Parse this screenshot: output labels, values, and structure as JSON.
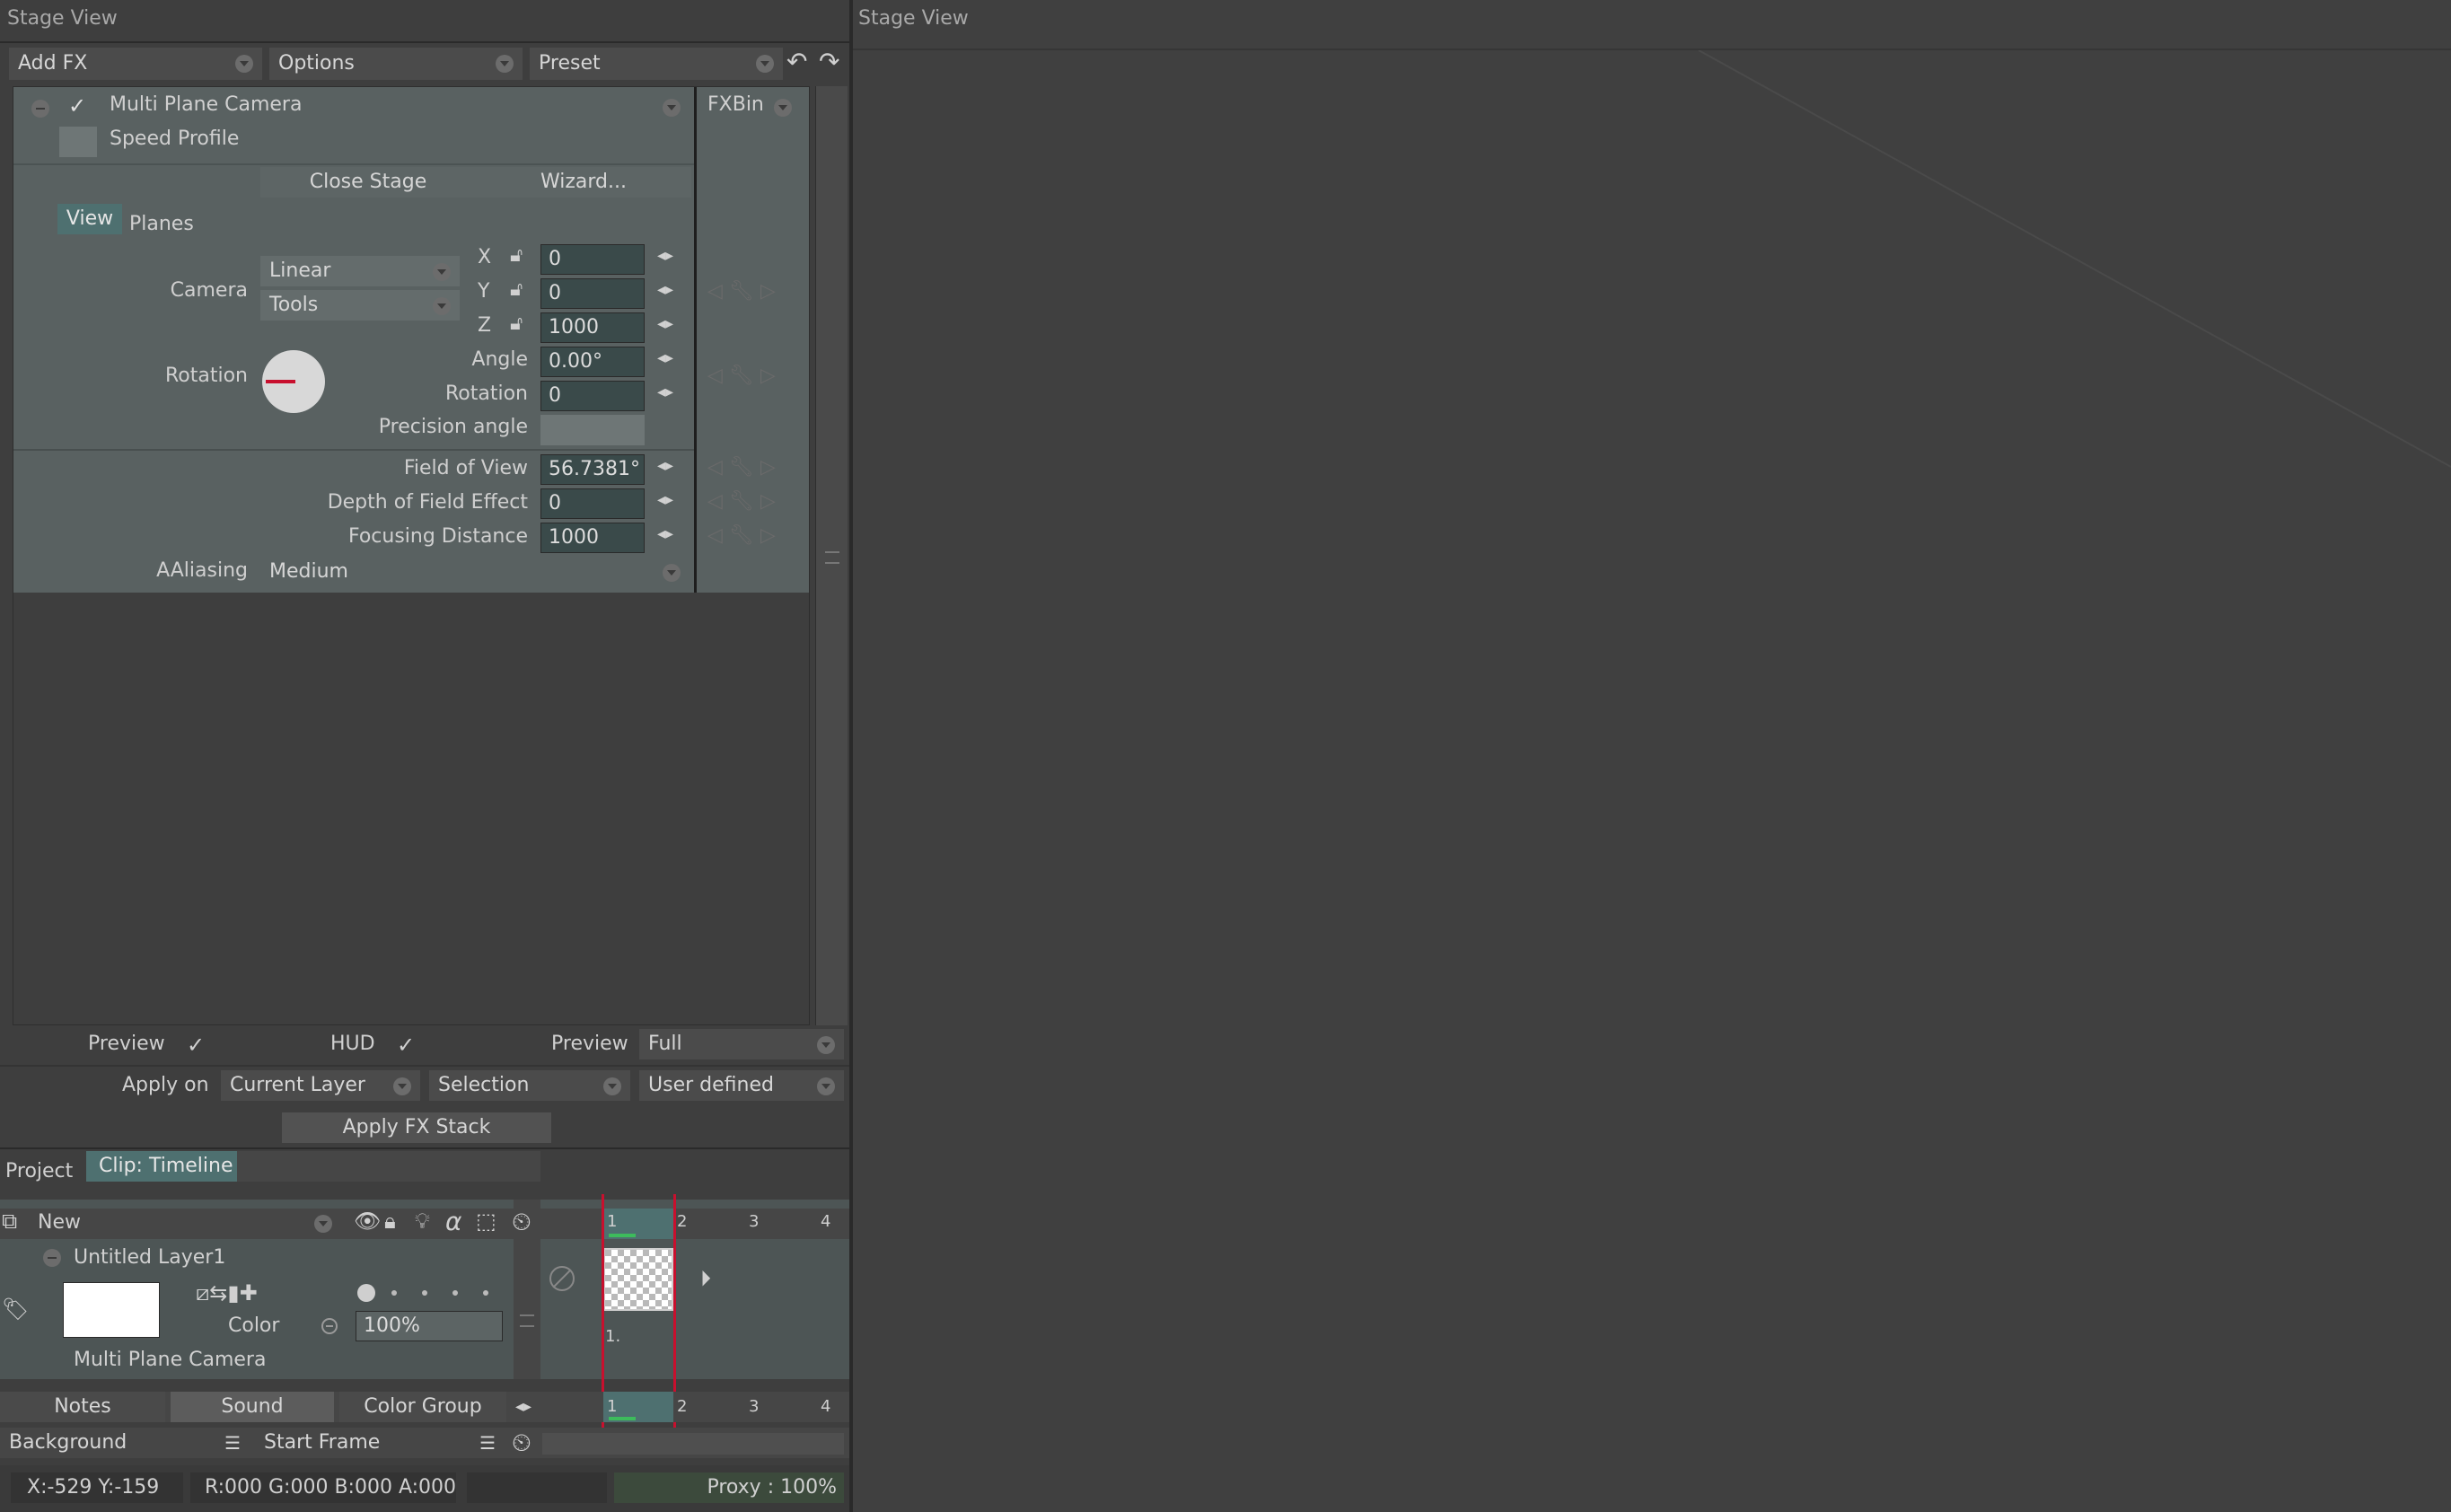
{
  "fx_panel": {
    "title": "Stage View",
    "add_fx": "Add FX",
    "options": "Options",
    "preset": "Preset",
    "fxbin": "FXBin",
    "fx_name": "Multi Plane Camera",
    "speed_profile": "Speed Profile",
    "close_stage": "Close Stage",
    "wizard": "Wizard...",
    "tabs": {
      "view": "View",
      "planes": "Planes"
    },
    "camera_label": "Camera",
    "camera_mode": "Linear",
    "camera_tools": "Tools",
    "x_label": "X",
    "x_value": "0",
    "y_label": "Y",
    "y_value": "0",
    "z_label": "Z",
    "z_value": "1000",
    "rotation_label": "Rotation",
    "angle_label": "Angle",
    "angle_value": "0.00°",
    "rotation_field_label": "Rotation",
    "rotation_value": "0",
    "precision_angle_label": "Precision angle",
    "fov_label": "Field of View",
    "fov_value": "56.7381°",
    "dof_label": "Depth of Field Effect",
    "dof_value": "0",
    "focus_label": "Focusing Distance",
    "focus_value": "1000",
    "aliasing_label": "AAliasing",
    "aliasing_value": "Medium",
    "preview_label": "Preview",
    "hud_label": "HUD",
    "preview2_label": "Preview",
    "preview2_value": "Full",
    "apply_on_label": "Apply on",
    "apply_on_layer": "Current Layer",
    "apply_on_selection": "Selection",
    "apply_on_range": "User defined",
    "apply_stack": "Apply FX Stack"
  },
  "timeline": {
    "tab_project": "Project",
    "tab_clip": "Clip: Timeline",
    "new_label": "New",
    "layer_name": "Untitled Layer1",
    "color_label": "Color",
    "opacity": "100%",
    "camera_name": "Multi Plane Camera",
    "frames": [
      "1",
      "2",
      "3",
      "4"
    ],
    "cell_label": "1.",
    "notes": "Notes",
    "sound": "Sound",
    "color_group": "Color Group",
    "background": "Background",
    "start_frame": "Start Frame"
  },
  "status": {
    "coords": "X:-529  Y:-159",
    "rgba": "R:000 G:000 B:000 A:000",
    "proxy": "Proxy : 100%"
  },
  "stage_view": {
    "title": "Stage View"
  }
}
